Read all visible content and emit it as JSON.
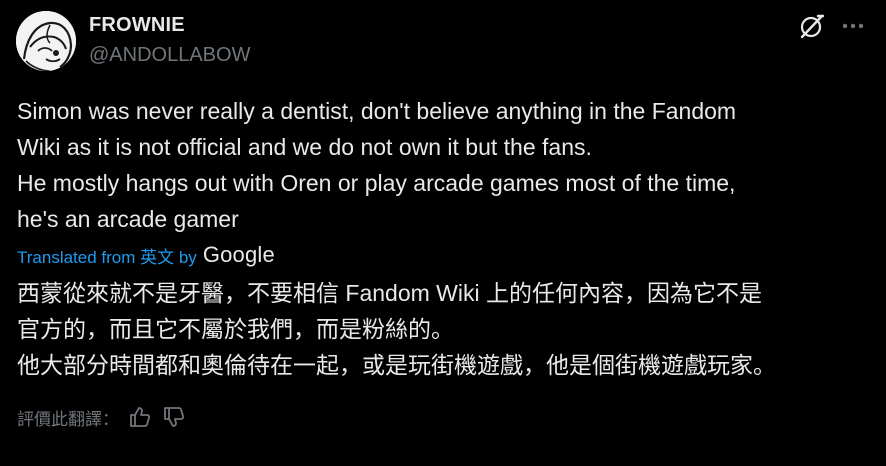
{
  "author": {
    "display_name": "FROWNIE",
    "handle": "@ANDOLLABOW"
  },
  "header_icons": {
    "grok": "grok-icon",
    "more": "more-icon"
  },
  "post": {
    "text": "Simon was never really a dentist, don't believe anything in the Fandom\nWiki as it is not official and we do not own it but the fans.\nHe mostly hangs out with Oren or play arcade games most of the time,\nhe's an arcade gamer",
    "translated_from_label": "Translated from 英文 by",
    "translator": "Google",
    "translated_text": "西蒙從來就不是牙醫，不要相信 Fandom Wiki 上的任何內容，因為它不是\n官方的，而且它不屬於我們，而是粉絲的。\n他大部分時間都和奧倫待在一起，或是玩街機遊戲，他是個街機遊戲玩家。"
  },
  "rating": {
    "label": "評價此翻譯：",
    "thumbs_up_icon": "thumbs-up-icon",
    "thumbs_down_icon": "thumbs-down-icon"
  },
  "colors": {
    "background": "#000000",
    "text_primary": "#e7e9ea",
    "text_secondary": "#71767b",
    "link": "#1d9bf0"
  }
}
